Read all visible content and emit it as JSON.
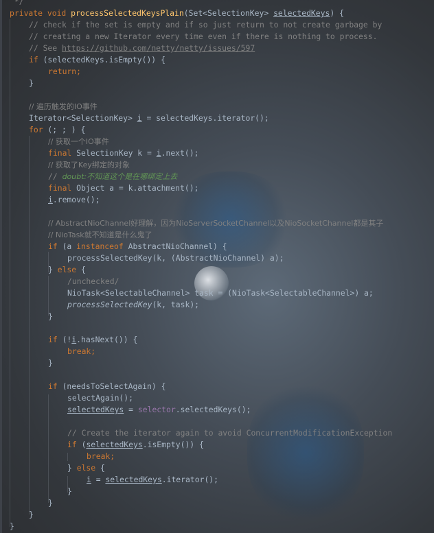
{
  "editor": {
    "theme_colors": {
      "keyword": "#cc7832",
      "method": "#ffc66d",
      "comment": "#808080",
      "field": "#9876aa",
      "text": "#a9b7c6",
      "todo": "#629755"
    },
    "lines": [
      {
        "id": "l0",
        "text": " */"
      },
      {
        "id": "l1",
        "parts": [
          "private void ",
          "processSelectedKeysPlain",
          "(Set<SelectionKey> ",
          "selectedKeys",
          ") {"
        ]
      },
      {
        "id": "l2",
        "text": "// check if the set is empty and if so just return to not create garbage by"
      },
      {
        "id": "l3",
        "text": "// creating a new Iterator every time even if there is nothing to process."
      },
      {
        "id": "l4",
        "parts": [
          "// See ",
          "https://github.com/netty/netty/issues/597"
        ]
      },
      {
        "id": "l5",
        "parts": [
          "if",
          " (selectedKeys.isEmpty()) {"
        ]
      },
      {
        "id": "l6",
        "text": "return;"
      },
      {
        "id": "l7",
        "text": "}"
      },
      {
        "id": "l8",
        "text": "// 遍历触发的IO事件"
      },
      {
        "id": "l9",
        "parts": [
          "Iterator<SelectionKey> ",
          "i",
          " = selectedKeys.iterator();"
        ]
      },
      {
        "id": "l10",
        "parts": [
          "for",
          " (; ; ) {"
        ]
      },
      {
        "id": "l11",
        "text": "// 获取一个IO事件"
      },
      {
        "id": "l12",
        "parts": [
          "final",
          " SelectionKey k = ",
          "i",
          ".next();"
        ]
      },
      {
        "id": "l13",
        "text": "// 获取了Key绑定的对象"
      },
      {
        "id": "l14",
        "parts": [
          "// ",
          "doubt:不知道这个是在哪绑定上去"
        ]
      },
      {
        "id": "l15",
        "parts": [
          "final",
          " Object a = k.attachment();"
        ]
      },
      {
        "id": "l16",
        "parts": [
          "i",
          ".remove();"
        ]
      },
      {
        "id": "l17",
        "text": "// AbstractNioChannel好理解，因为NioServerSocketChannel以及NioSocketChannel都是其子"
      },
      {
        "id": "l18",
        "text": "// NioTask就不知道是什么鬼了"
      },
      {
        "id": "l19",
        "parts": [
          "if",
          " (a ",
          "instanceof",
          " AbstractNioChannel) {"
        ]
      },
      {
        "id": "l20",
        "text": "processSelectedKey(k, (AbstractNioChannel) a);"
      },
      {
        "id": "l21",
        "parts": [
          "} ",
          "else",
          " {"
        ]
      },
      {
        "id": "l22",
        "text": "/unchecked/"
      },
      {
        "id": "l23",
        "text": "NioTask<SelectableChannel> task = (NioTask<SelectableChannel>) a;"
      },
      {
        "id": "l24",
        "parts": [
          "processSelectedKey",
          "(k, task);"
        ]
      },
      {
        "id": "l25",
        "text": "}"
      },
      {
        "id": "l26",
        "parts": [
          "if",
          " (!",
          "i",
          ".hasNext()) {"
        ]
      },
      {
        "id": "l27",
        "text": "break;"
      },
      {
        "id": "l28",
        "text": "}"
      },
      {
        "id": "l29",
        "parts": [
          "if",
          " (needsToSelectAgain) {"
        ]
      },
      {
        "id": "l30",
        "text": "selectAgain();"
      },
      {
        "id": "l31",
        "parts": [
          "selectedKeys",
          " = ",
          "selector",
          ".selectedKeys();"
        ]
      },
      {
        "id": "l32",
        "text": "// Create the iterator again to avoid ConcurrentModificationException"
      },
      {
        "id": "l33",
        "parts": [
          "if",
          " (",
          "selectedKeys",
          ".isEmpty()) {"
        ]
      },
      {
        "id": "l34",
        "text": "break;"
      },
      {
        "id": "l35",
        "parts": [
          "} ",
          "else",
          " {"
        ]
      },
      {
        "id": "l36",
        "parts": [
          "i",
          " = ",
          "selectedKeys",
          ".iterator();"
        ]
      },
      {
        "id": "l37",
        "text": "}"
      },
      {
        "id": "l38",
        "text": "}"
      },
      {
        "id": "l39",
        "text": "}"
      },
      {
        "id": "l40",
        "text": "}"
      }
    ]
  }
}
